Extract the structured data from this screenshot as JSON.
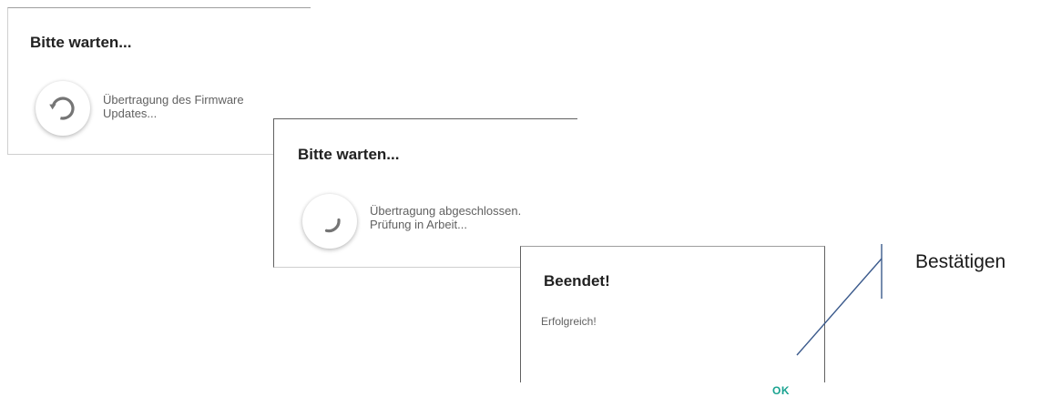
{
  "dialogs": [
    {
      "title": "Bitte warten...",
      "message_lines": [
        "Übertragung des Firmware",
        "Updates..."
      ]
    },
    {
      "title": "Bitte warten...",
      "message_lines": [
        "Übertragung abgeschlossen.",
        "Prüfung in Arbeit..."
      ]
    },
    {
      "title": "Beendet!",
      "message": "Erfolgreich!",
      "ok_label": "OK"
    }
  ],
  "callout": {
    "label": "Bestätigen"
  },
  "colors": {
    "ok_accent": "#1aa391",
    "spinner": "#757575",
    "callout_line": "#3b5a8c"
  }
}
